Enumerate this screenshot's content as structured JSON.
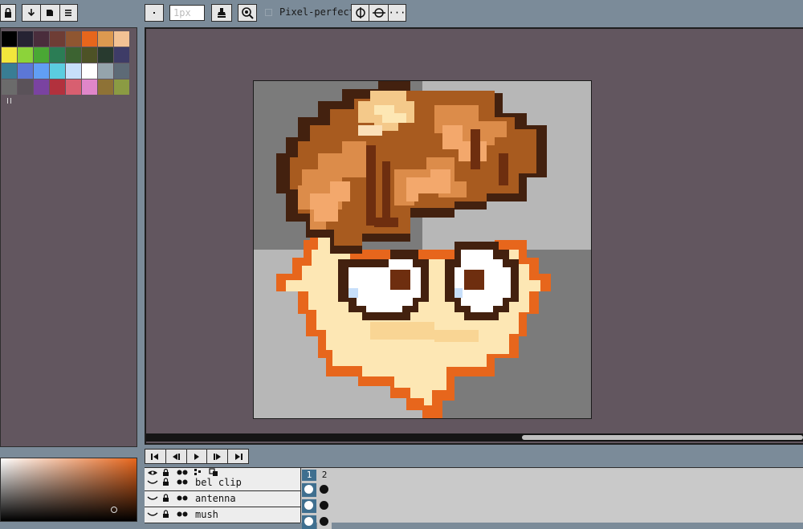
{
  "toolbar": {
    "buttons_left": [
      {
        "name": "lock-icon"
      },
      {
        "name": "download-icon"
      },
      {
        "name": "save-icon"
      },
      {
        "name": "menu-icon"
      }
    ],
    "brush_size_value": "1px",
    "pixel_perfect_label": "Pixel-perfect",
    "pixel_perfect_checked": false
  },
  "palette": {
    "colors": [
      "#000000",
      "#262333",
      "#4a2d3c",
      "#6e3d35",
      "#8f5631",
      "#e7661c",
      "#dc9950",
      "#f3c294",
      "#f2e63c",
      "#8cd33a",
      "#4aa834",
      "#2b7d55",
      "#3c6331",
      "#4d5226",
      "#283a2f",
      "#3e3c67",
      "#397d94",
      "#5c77d6",
      "#619ef4",
      "#5bcde0",
      "#c7dffa",
      "#ffffff",
      "#95a4ac",
      "#5d6a76",
      "#6b6b6b",
      "#5a5259",
      "#7a43a1",
      "#b2313d",
      "#d85f70",
      "#e086c9",
      "#8e7236",
      "#8b9b43"
    ]
  },
  "timeline": {
    "controls": [
      {
        "name": "first-frame-icon"
      },
      {
        "name": "prev-frame-icon"
      },
      {
        "name": "play-icon"
      },
      {
        "name": "next-frame-icon"
      },
      {
        "name": "last-frame-icon"
      }
    ],
    "layers": [
      {
        "name": "bel clip"
      },
      {
        "name": "antenna"
      },
      {
        "name": "mush"
      }
    ],
    "frames": [
      "1",
      "2"
    ]
  }
}
